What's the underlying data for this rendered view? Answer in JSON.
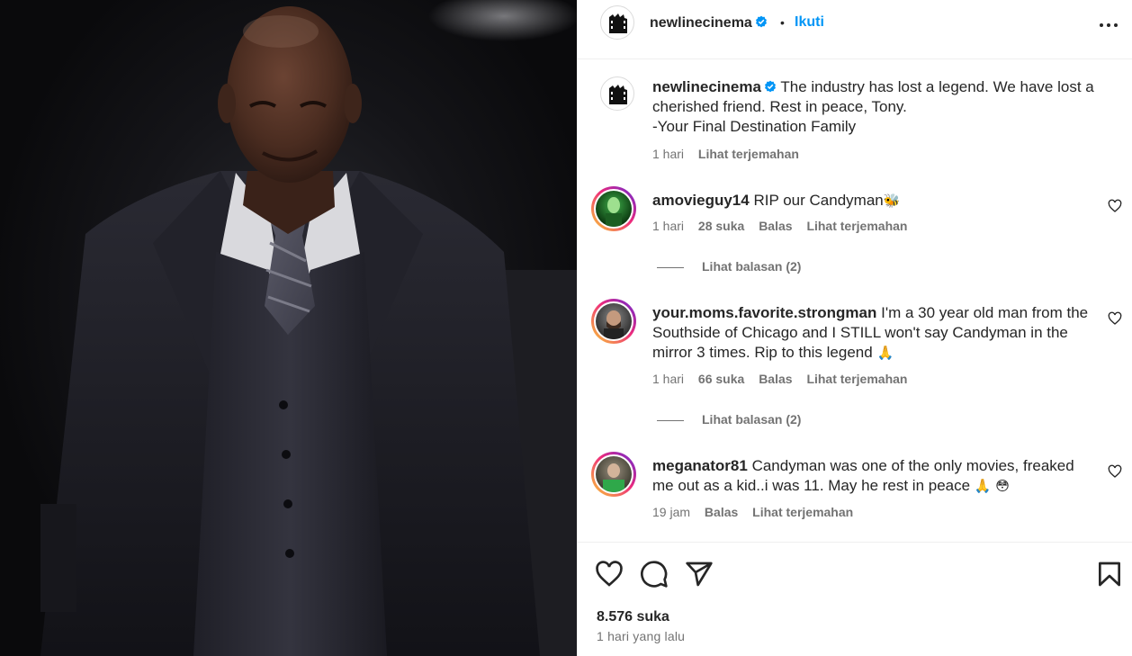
{
  "post": {
    "author": "newlinecinema",
    "follow_label": "Ikuti",
    "separator": "•",
    "caption_line1": "The industry has lost a legend. We have lost a",
    "caption_line2": "cherished friend. Rest in peace, Tony.",
    "caption_line3": "-Your Final Destination Family",
    "caption_time": "1 hari",
    "caption_translate": "Lihat terjemahan",
    "likes": "8.576 suka",
    "posted": "1 hari yang lalu"
  },
  "comments": [
    {
      "user": "amovieguy14",
      "text": "RIP our Candyman",
      "emoji": "🐝",
      "time": "1 hari",
      "likes": "28 suka",
      "reply": "Balas",
      "translate": "Lihat terjemahan",
      "view_replies": "Lihat balasan (2)"
    },
    {
      "user": "your.moms.favorite.strongman",
      "line1": "I'm a 30 year old man from the",
      "line2": "Southside of Chicago and I STILL won't say Candyman in the",
      "line3": "mirror 3 times. Rip to this legend",
      "emoji": "🙏",
      "time": "1 hari",
      "likes": "66 suka",
      "reply": "Balas",
      "translate": "Lihat terjemahan",
      "view_replies": "Lihat balasan (2)"
    },
    {
      "user": "meganator81",
      "line1": "Candyman was one of the only movies, freaked",
      "line2": "me out as a kid..i was 11. May he rest in peace",
      "emoji": "🙏",
      "emoji2": "😳",
      "time": "19 jam",
      "reply": "Balas",
      "translate": "Lihat terjemahan"
    }
  ],
  "icons": {
    "verified": "verified-badge-icon",
    "more": "more-options-icon",
    "like": "heart-icon",
    "comment": "comment-icon",
    "share": "share-icon",
    "save": "bookmark-icon"
  },
  "colors": {
    "accent": "#0095f6",
    "verified": "#0095f6",
    "muted": "#737373",
    "text": "#262626"
  }
}
